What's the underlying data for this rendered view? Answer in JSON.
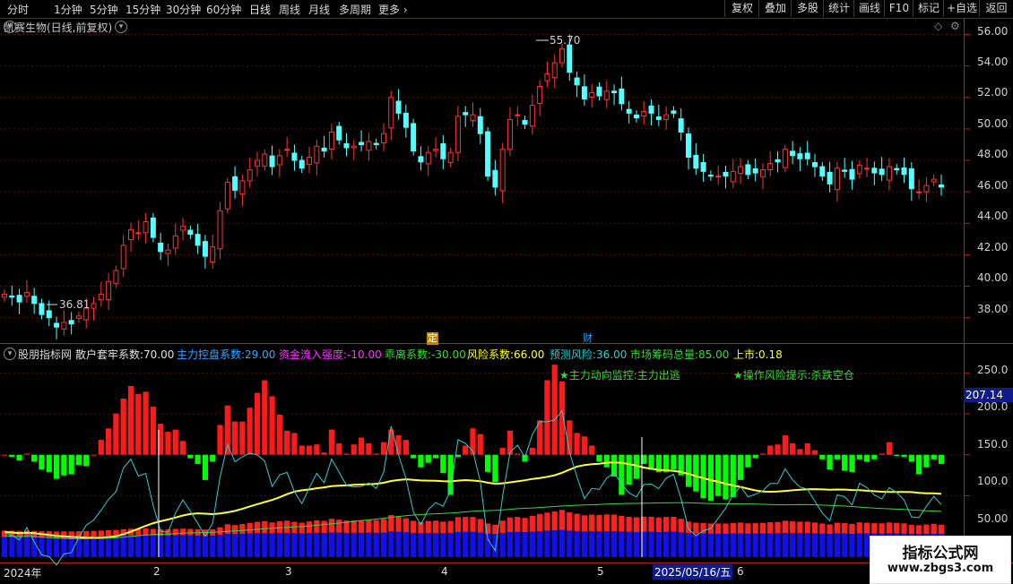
{
  "toolbar": {
    "periods": [
      "分时",
      "1分钟",
      "5分钟",
      "15分钟",
      "30分钟",
      "60分钟",
      "日线",
      "周线",
      "月线",
      "多周期",
      "更多"
    ],
    "actions": [
      "复权",
      "叠加",
      "多股",
      "统计",
      "画线",
      "F10",
      "标记",
      "+自选",
      "返回"
    ]
  },
  "main_chart": {
    "title": "凯赛生物(日线,前复权)",
    "price_ticks": [
      "56.00",
      "54.00",
      "52.00",
      "50.00",
      "48.00",
      "46.00",
      "44.00",
      "42.00",
      "40.00",
      "38.00"
    ],
    "high_label": "55.70",
    "low_label": "36.81",
    "markers": [
      "定",
      "财"
    ]
  },
  "indicator": {
    "name": "股朋指标网",
    "fields": [
      {
        "label": "散户套牢系数:",
        "value": "70.00",
        "color": "#e0e0e0"
      },
      {
        "label": "主力控盘系数:",
        "value": "29.00",
        "color": "#33a7ff"
      },
      {
        "label": "资金流入强度:",
        "value": "-10.00",
        "color": "#ff33ff"
      },
      {
        "label": "乖离系数:",
        "value": "-30.00",
        "color": "#33dd33"
      },
      {
        "label": "风险系数:",
        "value": "66.00",
        "color": "#ffff33"
      },
      {
        "label": "预测风险:",
        "value": "36.00",
        "color": "#33cccc"
      },
      {
        "label": "市场筹码总量:",
        "value": "85.00",
        "color": "#33dd33"
      },
      {
        "label": "上市:",
        "value": "0.18",
        "color": "#ffff33"
      }
    ],
    "notes": [
      "★主力动向监控:主力出逃",
      "★操作风险提示:杀跌空仓"
    ],
    "y_ticks": [
      "250.0",
      "200.0",
      "150.0",
      "100.0",
      "50.00"
    ],
    "current_value": "207.14"
  },
  "time_axis": {
    "labels": [
      "2024年",
      "2",
      "3",
      "4",
      "5",
      "6"
    ],
    "cursor_date": "2025/05/16/五"
  },
  "watermark": {
    "title": "指标公式网",
    "url": "www.zbgs3.com"
  },
  "chart_data": {
    "type": "candlestick",
    "title": "凯赛生物(日线,前复权)",
    "ylim": [
      36.5,
      56.6
    ],
    "closes": [
      39.5,
      39.3,
      39.0,
      39.6,
      38.9,
      38.2,
      38.0,
      37.4,
      37.7,
      37.6,
      38.1,
      38.6,
      38.9,
      39.5,
      40.3,
      41.0,
      42.6,
      43.6,
      43.4,
      44.1,
      43.1,
      42.2,
      42.3,
      43.2,
      43.8,
      43.3,
      42.6,
      41.9,
      42.5,
      44.8,
      46.6,
      46.1,
      46.7,
      47.4,
      48.0,
      48.4,
      47.6,
      48.3,
      48.7,
      48.0,
      47.5,
      48.2,
      48.9,
      48.6,
      49.8,
      49.3,
      48.8,
      48.9,
      49.0,
      49.2,
      49.0,
      49.7,
      52.0,
      51.0,
      50.1,
      48.6,
      47.9,
      48.5,
      48.7,
      48.1,
      48.5,
      50.8,
      50.9,
      50.9,
      49.7,
      47.0,
      46.3,
      48.7,
      50.6,
      50.9,
      50.3,
      51.5,
      52.7,
      53.5,
      54.2,
      55.1,
      53.6,
      52.8,
      51.9,
      52.3,
      52.1,
      52.4,
      52.3,
      51.6,
      51.0,
      50.7,
      51.1,
      51.0,
      50.6,
      50.9,
      51.0,
      49.8,
      48.2,
      47.5,
      47.3,
      47.0,
      47.0,
      47.0,
      47.3,
      47.6,
      47.1,
      47.2,
      47.4,
      47.8,
      47.9,
      48.7,
      48.3,
      48.1,
      48.1,
      47.6,
      47.0,
      46.5,
      47.5,
      47.3,
      46.8,
      47.7,
      47.5,
      47.2,
      47.1,
      47.6,
      47.4,
      47.1,
      46.2,
      46.0,
      46.4,
      46.8,
      46.3
    ],
    "osc_series": [
      {
        "name": "散户套牢系数",
        "color": "#e0e0e0"
      },
      {
        "name": "主力控盘系数",
        "color": "#33a7ff"
      },
      {
        "name": "风险系数",
        "color": "#ffff33"
      },
      {
        "name": "预测风险",
        "color": "#33cccc"
      },
      {
        "name": "市场筹码总量",
        "color": "#33dd33"
      }
    ],
    "osc_ylim": [
      25,
      270
    ]
  }
}
